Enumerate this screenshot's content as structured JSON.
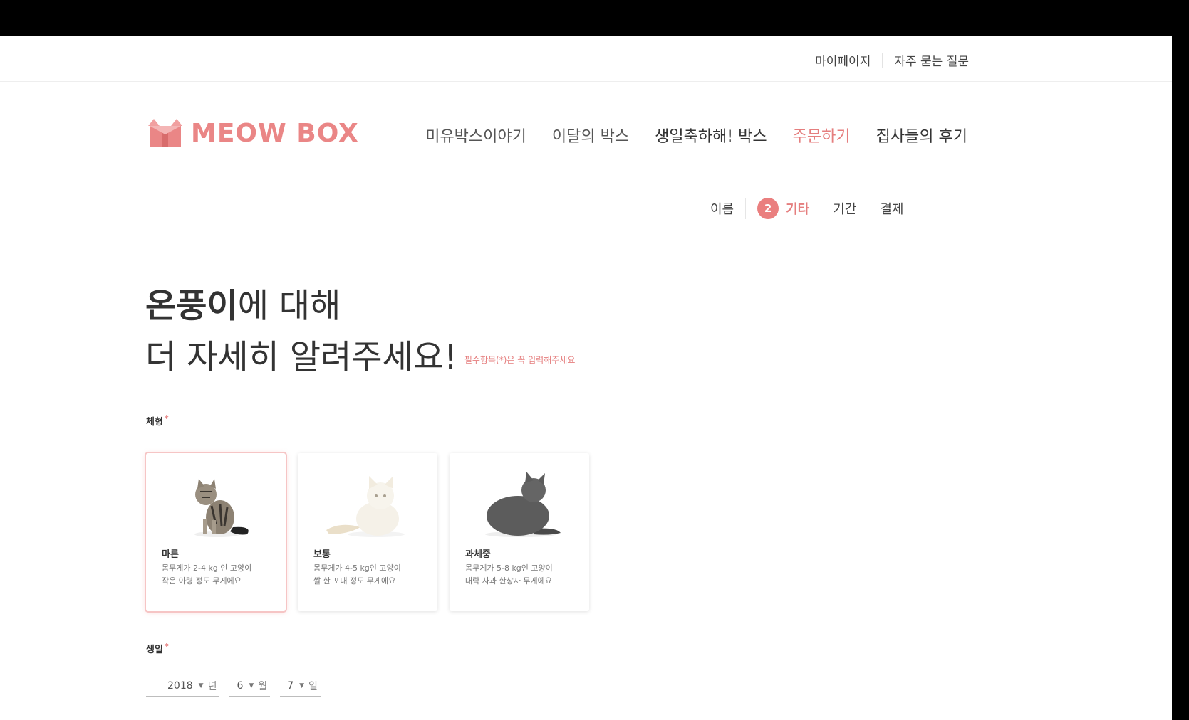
{
  "util": {
    "mypage": "마이페이지",
    "faq": "자주 묻는 질문"
  },
  "logo": {
    "text": "MEOW BOX"
  },
  "nav": {
    "story": "미유박스이야기",
    "monthly": "이달의 박스",
    "birthday": "생일축하해! 박스",
    "order": "주문하기",
    "reviews": "집사들의 후기"
  },
  "steps": {
    "name": "이름",
    "current_number": "2",
    "other": "기타",
    "period": "기간",
    "payment": "결제"
  },
  "heading": {
    "cat_name": "온풍이",
    "line1_rest": "에 대해",
    "line2": "더 자세히 알려주세요!",
    "required_note": "필수항목(*)은 꼭 입력해주세요"
  },
  "body_type": {
    "label": "체형",
    "star": "*",
    "options": [
      {
        "title": "마른",
        "desc1": "몸무게가 2-4 kg 인 고양이",
        "desc2": "작은 아령 정도 무게에요",
        "selected": true
      },
      {
        "title": "보통",
        "desc1": "몸무게가 4-5 kg인 고양이",
        "desc2": "쌀 한 포대 정도 무게에요",
        "selected": false
      },
      {
        "title": "과체중",
        "desc1": "몸무게가 5-8 kg인 고양이",
        "desc2": "대략 사과 한상자 무게에요",
        "selected": false
      }
    ]
  },
  "birthday": {
    "label": "생일",
    "star": "*",
    "year": "2018",
    "year_unit": "년",
    "month": "6",
    "month_unit": "월",
    "day": "7",
    "day_unit": "일"
  },
  "colors": {
    "accent": "#e57e7e",
    "text": "#333333"
  }
}
